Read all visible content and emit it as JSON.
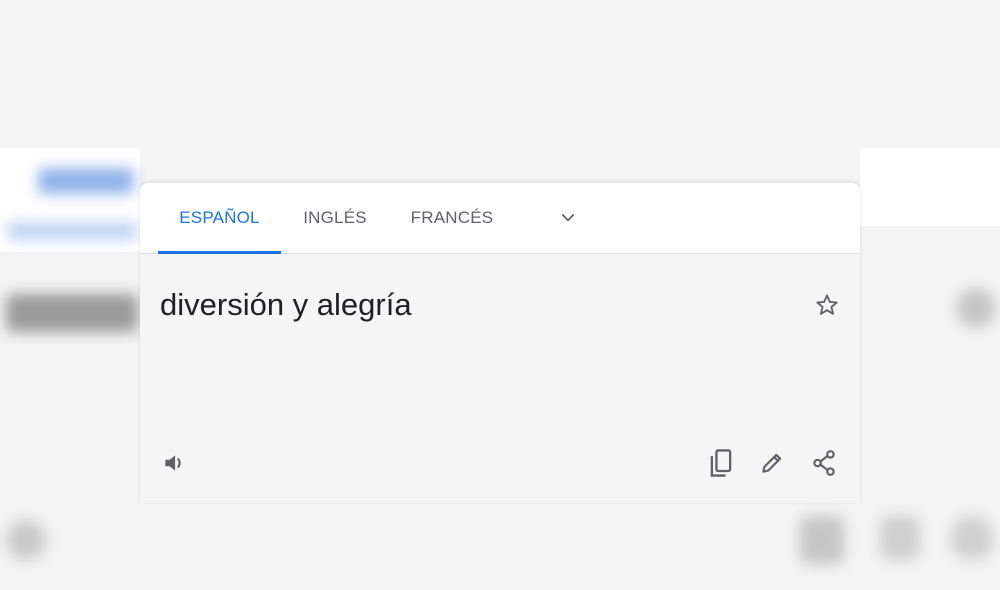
{
  "tabs": [
    {
      "label": "ESPAÑOL",
      "active": true
    },
    {
      "label": "INGLÉS",
      "active": false
    },
    {
      "label": "FRANCÉS",
      "active": false
    }
  ],
  "more_languages_icon": "chevron-down-icon",
  "translation": {
    "text": "diversión y alegría"
  },
  "actions": {
    "favorite_icon": "star-outline-icon",
    "listen_icon": "speaker-icon",
    "copy_icon": "copy-icon",
    "edit_icon": "pencil-icon",
    "share_icon": "share-icon"
  },
  "colors": {
    "accent": "#1a73e8",
    "text": "#202124",
    "icon": "#5f6368",
    "card_background": "#f5f5f5",
    "tabs_background": "#ffffff"
  }
}
